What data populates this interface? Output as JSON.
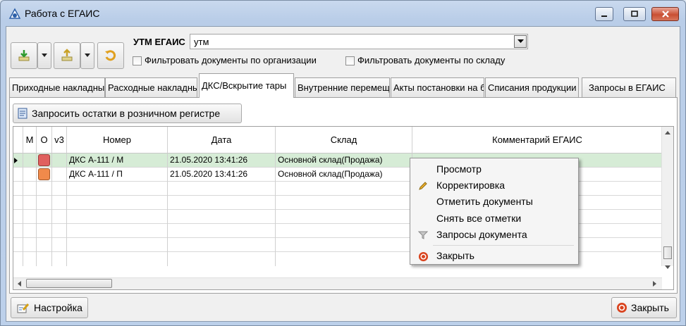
{
  "window": {
    "title": "Работа с ЕГАИС"
  },
  "toolbar": {
    "utm_label": "УТМ ЕГАИС",
    "utm_value": "утм",
    "filter_org_label": "Фильтровать документы по организации",
    "filter_store_label": "Фильтровать документы по складу"
  },
  "tabs": [
    {
      "label": "Приходные накладные"
    },
    {
      "label": "Расходные накладные"
    },
    {
      "label": "ДКС/Вскрытие тары"
    },
    {
      "label": "Внутренние перемещения"
    },
    {
      "label": "Акты постановки на баланс"
    },
    {
      "label": "Списания продукции"
    },
    {
      "label": "Запросы в ЕГАИС"
    }
  ],
  "request_button": "Запросить остатки в розничном регистре",
  "grid": {
    "columns": [
      "М",
      "О",
      "v3",
      "Номер",
      "Дата",
      "Склад",
      "Комментарий ЕГАИС"
    ],
    "rows": [
      {
        "number": "ДКС А-111 / М",
        "date": "21.05.2020 13:41:26",
        "store": "Основной склад(Продажа)",
        "status_color": "#e0605e"
      },
      {
        "number": "ДКС А-111 / П",
        "date": "21.05.2020 13:41:26",
        "store": "Основной склад(Продажа)",
        "status_color": "#f08a4b"
      }
    ]
  },
  "context_menu": {
    "items": [
      {
        "label": "Просмотр",
        "icon": ""
      },
      {
        "label": "Корректировка",
        "icon": "pencil-icon"
      },
      {
        "label": "Отметить документы",
        "icon": ""
      },
      {
        "label": "Снять все отметки",
        "icon": ""
      },
      {
        "label": "Запросы документа",
        "icon": "funnel-icon"
      },
      {
        "label": "Закрыть",
        "icon": "close-circle-icon"
      }
    ]
  },
  "footer": {
    "settings_label": "Настройка",
    "close_label": "Закрыть"
  },
  "colors": {
    "selected_row": "#d6ecd6",
    "accent_close": "#d9431e"
  }
}
